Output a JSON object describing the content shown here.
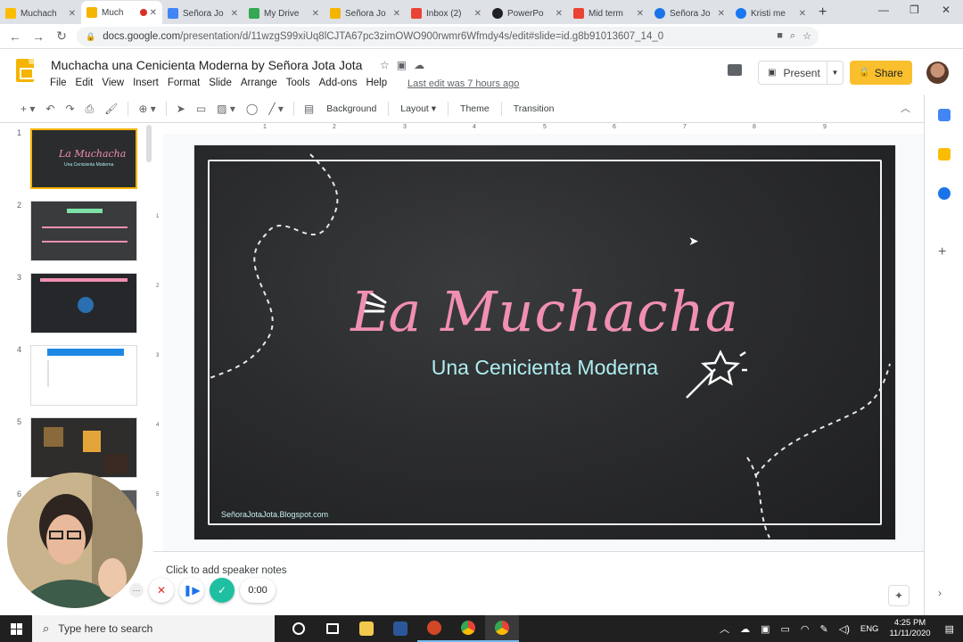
{
  "browser": {
    "tabs": [
      {
        "label": "Muchach",
        "color": "#fbbc04"
      },
      {
        "label": "Much",
        "color": "#f4b400",
        "active": true
      },
      {
        "label": "Señora Jo",
        "color": "#4285f4"
      },
      {
        "label": "My Drive",
        "color": "#34a853"
      },
      {
        "label": "Señora Jo",
        "color": "#f4b400"
      },
      {
        "label": "Inbox (2)",
        "color": "#ea4335"
      },
      {
        "label": "PowerPo",
        "color": "#202124"
      },
      {
        "label": "Mid term",
        "color": "#ea4335"
      },
      {
        "label": "Señora Jo",
        "color": "#1a73e8"
      },
      {
        "label": "Kristi me",
        "color": "#1877f2"
      }
    ],
    "url_host": "docs.google.com",
    "url_path": "/presentation/d/11wzgS99xiUq8lCJTA67pc3zimOWO900rwmr6Wfmdy4s/edit#slide=id.g8b91013607_14_0"
  },
  "app": {
    "doc_title": "Muchacha una Cenicienta Moderna by Señora Jota Jota",
    "menus": [
      "File",
      "Edit",
      "View",
      "Insert",
      "Format",
      "Slide",
      "Arrange",
      "Tools",
      "Add-ons",
      "Help"
    ],
    "last_edit": "Last edit was 7 hours ago",
    "present_label": "Present",
    "share_label": "Share",
    "accent": "#f9bf2c"
  },
  "toolbar": {
    "background": "Background",
    "layout": "Layout",
    "theme": "Theme",
    "transition": "Transition"
  },
  "filmstrip": {
    "numbers": [
      "1",
      "2",
      "3",
      "4",
      "5",
      "6"
    ]
  },
  "ruler": {
    "h_ticks": [
      "1",
      "2",
      "3",
      "4",
      "5",
      "6",
      "7",
      "8",
      "9"
    ],
    "v_ticks": [
      "1",
      "2",
      "3",
      "4",
      "5"
    ]
  },
  "slide": {
    "title": "La Muchacha",
    "subtitle": "Una Cenicienta Moderna",
    "footer": "SeñoraJotaJota.Blogspot.com",
    "title_color": "#f08fb1",
    "subtitle_color": "#aeeef0"
  },
  "notes": {
    "placeholder": "Click to add speaker notes"
  },
  "recorder": {
    "time": "0:00"
  },
  "taskbar": {
    "search_placeholder": "Type here to search",
    "lang": "ENG",
    "time": "4:25 PM",
    "date": "11/11/2020"
  }
}
